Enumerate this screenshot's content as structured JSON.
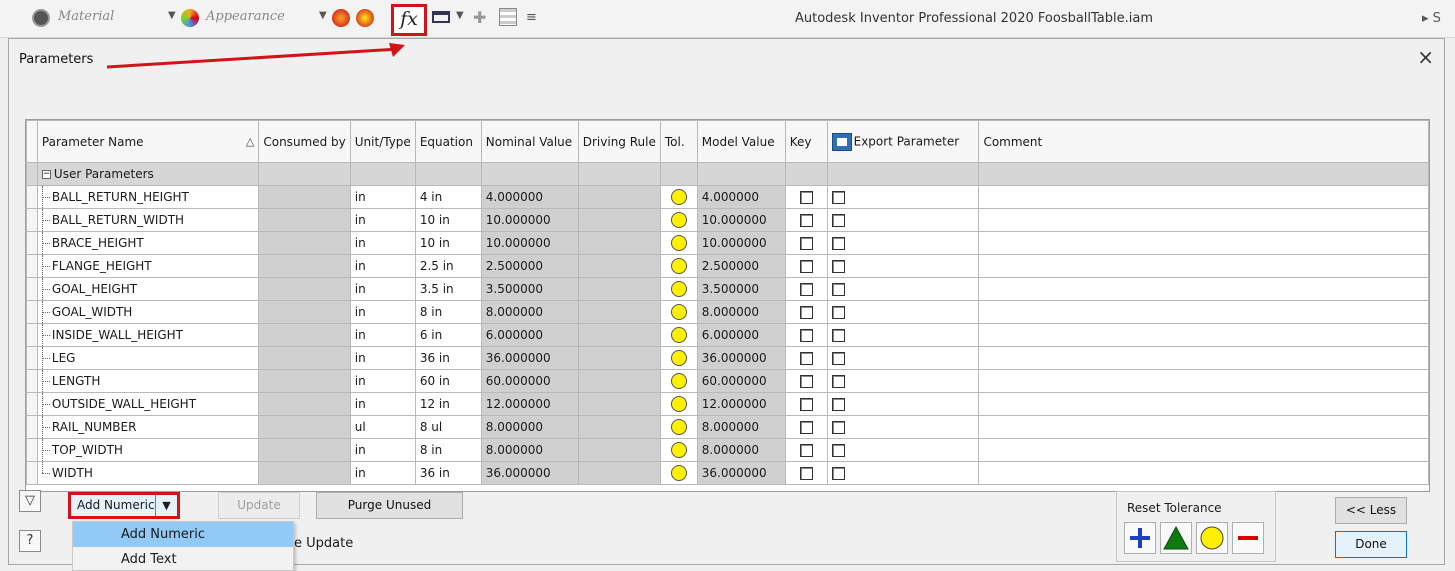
{
  "ribbon": {
    "material_label": "Material",
    "appearance_label": "Appearance",
    "fx_label": "fx",
    "app_title": "Autodesk Inventor Professional 2020   FoosballTable.iam",
    "right_fragment": "S"
  },
  "dialog": {
    "title": "Parameters",
    "close_glyph": "×"
  },
  "table": {
    "headers": {
      "name": "Parameter Name",
      "sort_indicator": "△",
      "consumed_by": "Consumed by",
      "unit": "Unit/Type",
      "equation": "Equation",
      "nominal": "Nominal Value",
      "driving": "Driving Rule",
      "tol": "Tol.",
      "model": "Model Value",
      "key": "Key",
      "export": "Export Parameter",
      "comment": "Comment"
    },
    "group_label": "User Parameters",
    "rows": [
      {
        "name": "BALL_RETURN_HEIGHT",
        "unit": "in",
        "equation": "4 in",
        "nominal": "4.000000",
        "model": "4.000000"
      },
      {
        "name": "BALL_RETURN_WIDTH",
        "unit": "in",
        "equation": "10 in",
        "nominal": "10.000000",
        "model": "10.000000"
      },
      {
        "name": "BRACE_HEIGHT",
        "unit": "in",
        "equation": "10 in",
        "nominal": "10.000000",
        "model": "10.000000"
      },
      {
        "name": "FLANGE_HEIGHT",
        "unit": "in",
        "equation": "2.5 in",
        "nominal": "2.500000",
        "model": "2.500000"
      },
      {
        "name": "GOAL_HEIGHT",
        "unit": "in",
        "equation": "3.5 in",
        "nominal": "3.500000",
        "model": "3.500000"
      },
      {
        "name": "GOAL_WIDTH",
        "unit": "in",
        "equation": "8 in",
        "nominal": "8.000000",
        "model": "8.000000"
      },
      {
        "name": "INSIDE_WALL_HEIGHT",
        "unit": "in",
        "equation": "6 in",
        "nominal": "6.000000",
        "model": "6.000000"
      },
      {
        "name": "LEG",
        "unit": "in",
        "equation": "36 in",
        "nominal": "36.000000",
        "model": "36.000000"
      },
      {
        "name": "LENGTH",
        "unit": "in",
        "equation": "60 in",
        "nominal": "60.000000",
        "model": "60.000000"
      },
      {
        "name": "OUTSIDE_WALL_HEIGHT",
        "unit": "in",
        "equation": "12 in",
        "nominal": "12.000000",
        "model": "12.000000"
      },
      {
        "name": "RAIL_NUMBER",
        "unit": "ul",
        "equation": "8 ul",
        "nominal": "8.000000",
        "model": "8.000000"
      },
      {
        "name": "TOP_WIDTH",
        "unit": "in",
        "equation": "8 in",
        "nominal": "8.000000",
        "model": "8.000000"
      },
      {
        "name": "WIDTH",
        "unit": "in",
        "equation": "36 in",
        "nominal": "36.000000",
        "model": "36.000000"
      }
    ]
  },
  "controls": {
    "add_numeric": "Add Numeric",
    "update": "Update",
    "purge_unused": "Purge Unused",
    "immediate_update": "e Update",
    "menu_items": [
      "Add Numeric",
      "Add Text"
    ],
    "reset_tolerance": "Reset Tolerance",
    "less": "<< Less",
    "done": "Done"
  },
  "colors": {
    "highlight_red": "#d0141a",
    "tolerance_yellow": "#ffef00",
    "menu_highlight": "#91c9f7",
    "plus_blue": "#1c3fc8",
    "triangle_green": "#0f7a0f",
    "minus_red": "#d60000"
  },
  "icons": [
    "material-icon",
    "appearance-icon",
    "fx-icon",
    "filter-icon",
    "help-icon",
    "export-parameter-icon",
    "tolerance-lamp-icon",
    "plus-icon",
    "triangle-icon",
    "circle-icon",
    "minus-icon"
  ]
}
